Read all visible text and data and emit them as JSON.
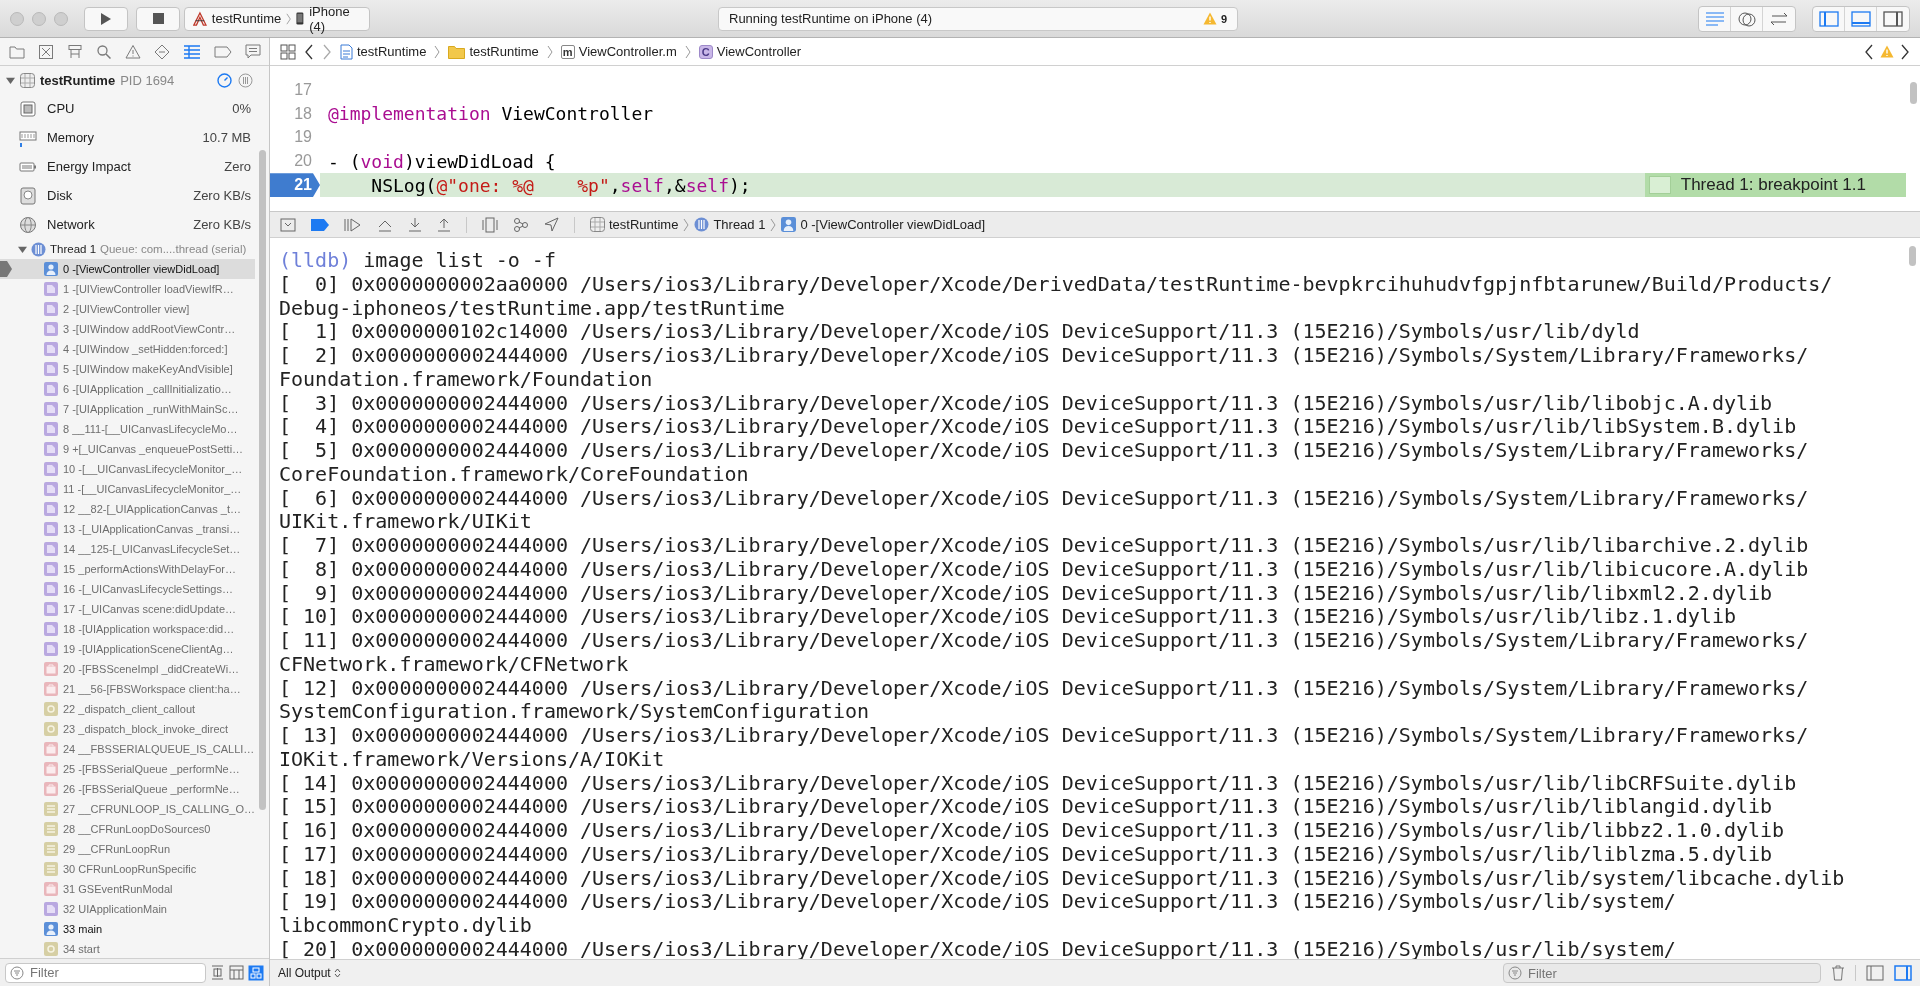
{
  "toolbar": {
    "scheme": "testRuntime",
    "device": "iPhone (4)",
    "status": "Running testRuntime on iPhone (4)",
    "warning_count": "9"
  },
  "navigator_tabs": [
    {
      "kind": "folder",
      "selected": false
    },
    {
      "kind": "source",
      "selected": false
    },
    {
      "kind": "symbol",
      "selected": false
    },
    {
      "kind": "search",
      "selected": false
    },
    {
      "kind": "issue",
      "selected": false
    },
    {
      "kind": "test",
      "selected": false
    },
    {
      "kind": "debug",
      "selected": true
    },
    {
      "kind": "breakpoint",
      "selected": false
    },
    {
      "kind": "report",
      "selected": false
    }
  ],
  "process": {
    "name": "testRuntime",
    "pid": "PID 1694",
    "expanded": true
  },
  "gauges": [
    {
      "kind": "cpu",
      "label": "CPU",
      "value": "0%"
    },
    {
      "kind": "memory",
      "label": "Memory",
      "value": "10.7 MB"
    },
    {
      "kind": "energy",
      "label": "Energy Impact",
      "value": "Zero"
    },
    {
      "kind": "disk",
      "label": "Disk",
      "value": "Zero KB/s"
    },
    {
      "kind": "network",
      "label": "Network",
      "value": "Zero KB/s"
    }
  ],
  "thread": {
    "name": "Thread 1",
    "queue": "Queue: com....thread (serial)",
    "expanded": true
  },
  "frames": [
    {
      "label": "0 -[ViewController viewDidLoad]",
      "kind": "user",
      "selected": true
    },
    {
      "label": "1 -[UIViewController loadViewIfR…",
      "kind": "uikit",
      "selected": false
    },
    {
      "label": "2 -[UIViewController view]",
      "kind": "uikit",
      "selected": false
    },
    {
      "label": "3 -[UIWindow addRootViewContr…",
      "kind": "uikit",
      "selected": false
    },
    {
      "label": "4 -[UIWindow _setHidden:forced:]",
      "kind": "uikit",
      "selected": false
    },
    {
      "label": "5 -[UIWindow makeKeyAndVisible]",
      "kind": "uikit",
      "selected": false
    },
    {
      "label": "6 -[UIApplication _callInitializatio…",
      "kind": "uikit",
      "selected": false
    },
    {
      "label": "7 -[UIApplication _runWithMainSc…",
      "kind": "uikit",
      "selected": false
    },
    {
      "label": "8 __111-[__UICanvasLifecycleMo…",
      "kind": "uikit",
      "selected": false
    },
    {
      "label": "9 +[_UICanvas _enqueuePostSetti…",
      "kind": "uikit",
      "selected": false
    },
    {
      "label": "10 -[__UICanvasLifecycleMonitor_…",
      "kind": "uikit",
      "selected": false
    },
    {
      "label": "11 -[__UICanvasLifecycleMonitor_…",
      "kind": "uikit",
      "selected": false
    },
    {
      "label": "12 __82-[_UIApplicationCanvas _t…",
      "kind": "uikit",
      "selected": false
    },
    {
      "label": "13 -[_UIApplicationCanvas _transi…",
      "kind": "uikit",
      "selected": false
    },
    {
      "label": "14 __125-[_UICanvasLifecycleSet…",
      "kind": "uikit",
      "selected": false
    },
    {
      "label": "15 _performActionsWithDelayFor…",
      "kind": "uikit",
      "selected": false
    },
    {
      "label": "16 -[_UICanvasLifecycleSettings…",
      "kind": "uikit",
      "selected": false
    },
    {
      "label": "17 -[_UICanvas scene:didUpdate…",
      "kind": "uikit",
      "selected": false
    },
    {
      "label": "18 -[UIApplication workspace:did…",
      "kind": "uikit",
      "selected": false
    },
    {
      "label": "19 -[UIApplicationSceneClientAg…",
      "kind": "uikit",
      "selected": false
    },
    {
      "label": "20 -[FBSSceneImpl _didCreateWi…",
      "kind": "frontboard",
      "selected": false
    },
    {
      "label": "21 __56-[FBSWorkspace client:ha…",
      "kind": "frontboard",
      "selected": false
    },
    {
      "label": "22 _dispatch_client_callout",
      "kind": "dispatch",
      "selected": false
    },
    {
      "label": "23 _dispatch_block_invoke_direct",
      "kind": "dispatch",
      "selected": false
    },
    {
      "label": "24 __FBSSERIALQUEUE_IS_CALLI…",
      "kind": "frontboard",
      "selected": false
    },
    {
      "label": "25 -[FBSSerialQueue _performNe…",
      "kind": "frontboard",
      "selected": false
    },
    {
      "label": "26 -[FBSSerialQueue _performNe…",
      "kind": "frontboard",
      "selected": false
    },
    {
      "label": "27 __CFRUNLOOP_IS_CALLING_O…",
      "kind": "corefoundation",
      "selected": false
    },
    {
      "label": "28 __CFRunLoopDoSources0",
      "kind": "corefoundation",
      "selected": false
    },
    {
      "label": "29 __CFRunLoopRun",
      "kind": "corefoundation",
      "selected": false
    },
    {
      "label": "30 CFRunLoopRunSpecific",
      "kind": "corefoundation",
      "selected": false
    },
    {
      "label": "31 GSEventRunModal",
      "kind": "frontboard",
      "selected": false
    },
    {
      "label": "32 UIApplicationMain",
      "kind": "uikit",
      "selected": false
    },
    {
      "label": "33 main",
      "kind": "user",
      "selected": false
    },
    {
      "label": "34 start",
      "kind": "dispatch",
      "selected": false
    }
  ],
  "navigator_filter": {
    "placeholder": "Filter"
  },
  "jump_bar": [
    {
      "kind": "project",
      "label": "testRuntime"
    },
    {
      "kind": "folder",
      "label": "testRuntime"
    },
    {
      "kind": "file",
      "glyph": "m",
      "label": "ViewController.m"
    },
    {
      "kind": "class",
      "glyph": "C",
      "label": "ViewController"
    }
  ],
  "editor": {
    "lines": [
      {
        "number": "17",
        "breakpoint": false,
        "current": false
      },
      {
        "number": "18",
        "breakpoint": false,
        "current": false,
        "tokens": [
          {
            "kind": "keyword",
            "text": "@implementation"
          },
          {
            "kind": "plain",
            "text": " ViewController"
          }
        ]
      },
      {
        "number": "19",
        "breakpoint": false,
        "current": false
      },
      {
        "number": "20",
        "breakpoint": false,
        "current": false,
        "tokens": [
          {
            "kind": "plain",
            "text": "- ("
          },
          {
            "kind": "keyword",
            "text": "void"
          },
          {
            "kind": "plain",
            "text": ")viewDidLoad {"
          }
        ]
      },
      {
        "number": "21",
        "breakpoint": true,
        "current": true,
        "tokens": [
          {
            "kind": "plain",
            "text": "    NSLog("
          },
          {
            "kind": "string",
            "text": "@\"one: %@    %p\""
          },
          {
            "kind": "plain",
            "text": ","
          },
          {
            "kind": "keyword",
            "text": "self"
          },
          {
            "kind": "plain",
            "text": ",&"
          },
          {
            "kind": "keyword",
            "text": "self"
          },
          {
            "kind": "plain",
            "text": ");"
          }
        ]
      }
    ],
    "annotation": "Thread 1: breakpoint 1.1"
  },
  "debug_bar": {
    "path": [
      {
        "kind": "app",
        "label": "testRuntime"
      },
      {
        "kind": "thread",
        "label": "Thread 1"
      },
      {
        "kind": "user",
        "label": "0 -[ViewController viewDidLoad]"
      }
    ]
  },
  "console": {
    "prompt": "(lldb)",
    "command": "image list -o -f",
    "output": [
      "[  0] 0x0000000002aa0000 /Users/ios3/Library/Developer/Xcode/DerivedData/testRuntime-bevpkrcihuhudvfgpjnfbtarunew/Build/Products/",
      "Debug-iphoneos/testRuntime.app/testRuntime",
      "[  1] 0x0000000102c14000 /Users/ios3/Library/Developer/Xcode/iOS DeviceSupport/11.3 (15E216)/Symbols/usr/lib/dyld",
      "[  2] 0x0000000002444000 /Users/ios3/Library/Developer/Xcode/iOS DeviceSupport/11.3 (15E216)/Symbols/System/Library/Frameworks/",
      "Foundation.framework/Foundation",
      "[  3] 0x0000000002444000 /Users/ios3/Library/Developer/Xcode/iOS DeviceSupport/11.3 (15E216)/Symbols/usr/lib/libobjc.A.dylib",
      "[  4] 0x0000000002444000 /Users/ios3/Library/Developer/Xcode/iOS DeviceSupport/11.3 (15E216)/Symbols/usr/lib/libSystem.B.dylib",
      "[  5] 0x0000000002444000 /Users/ios3/Library/Developer/Xcode/iOS DeviceSupport/11.3 (15E216)/Symbols/System/Library/Frameworks/",
      "CoreFoundation.framework/CoreFoundation",
      "[  6] 0x0000000002444000 /Users/ios3/Library/Developer/Xcode/iOS DeviceSupport/11.3 (15E216)/Symbols/System/Library/Frameworks/",
      "UIKit.framework/UIKit",
      "[  7] 0x0000000002444000 /Users/ios3/Library/Developer/Xcode/iOS DeviceSupport/11.3 (15E216)/Symbols/usr/lib/libarchive.2.dylib",
      "[  8] 0x0000000002444000 /Users/ios3/Library/Developer/Xcode/iOS DeviceSupport/11.3 (15E216)/Symbols/usr/lib/libicucore.A.dylib",
      "[  9] 0x0000000002444000 /Users/ios3/Library/Developer/Xcode/iOS DeviceSupport/11.3 (15E216)/Symbols/usr/lib/libxml2.2.dylib",
      "[ 10] 0x0000000002444000 /Users/ios3/Library/Developer/Xcode/iOS DeviceSupport/11.3 (15E216)/Symbols/usr/lib/libz.1.dylib",
      "[ 11] 0x0000000002444000 /Users/ios3/Library/Developer/Xcode/iOS DeviceSupport/11.3 (15E216)/Symbols/System/Library/Frameworks/",
      "CFNetwork.framework/CFNetwork",
      "[ 12] 0x0000000002444000 /Users/ios3/Library/Developer/Xcode/iOS DeviceSupport/11.3 (15E216)/Symbols/System/Library/Frameworks/",
      "SystemConfiguration.framework/SystemConfiguration",
      "[ 13] 0x0000000002444000 /Users/ios3/Library/Developer/Xcode/iOS DeviceSupport/11.3 (15E216)/Symbols/System/Library/Frameworks/",
      "IOKit.framework/Versions/A/IOKit",
      "[ 14] 0x0000000002444000 /Users/ios3/Library/Developer/Xcode/iOS DeviceSupport/11.3 (15E216)/Symbols/usr/lib/libCRFSuite.dylib",
      "[ 15] 0x0000000002444000 /Users/ios3/Library/Developer/Xcode/iOS DeviceSupport/11.3 (15E216)/Symbols/usr/lib/liblangid.dylib",
      "[ 16] 0x0000000002444000 /Users/ios3/Library/Developer/Xcode/iOS DeviceSupport/11.3 (15E216)/Symbols/usr/lib/libbz2.1.0.dylib",
      "[ 17] 0x0000000002444000 /Users/ios3/Library/Developer/Xcode/iOS DeviceSupport/11.3 (15E216)/Symbols/usr/lib/liblzma.5.dylib",
      "[ 18] 0x0000000002444000 /Users/ios3/Library/Developer/Xcode/iOS DeviceSupport/11.3 (15E216)/Symbols/usr/lib/system/libcache.dylib",
      "[ 19] 0x0000000002444000 /Users/ios3/Library/Developer/Xcode/iOS DeviceSupport/11.3 (15E216)/Symbols/usr/lib/system/",
      "libcommonCrypto.dylib",
      "[ 20] 0x0000000002444000 /Users/ios3/Library/Developer/Xcode/iOS DeviceSupport/11.3 (15E216)/Symbols/usr/lib/system/"
    ]
  },
  "console_footer": {
    "output_selector": "All Output",
    "filter_placeholder": "Filter"
  }
}
